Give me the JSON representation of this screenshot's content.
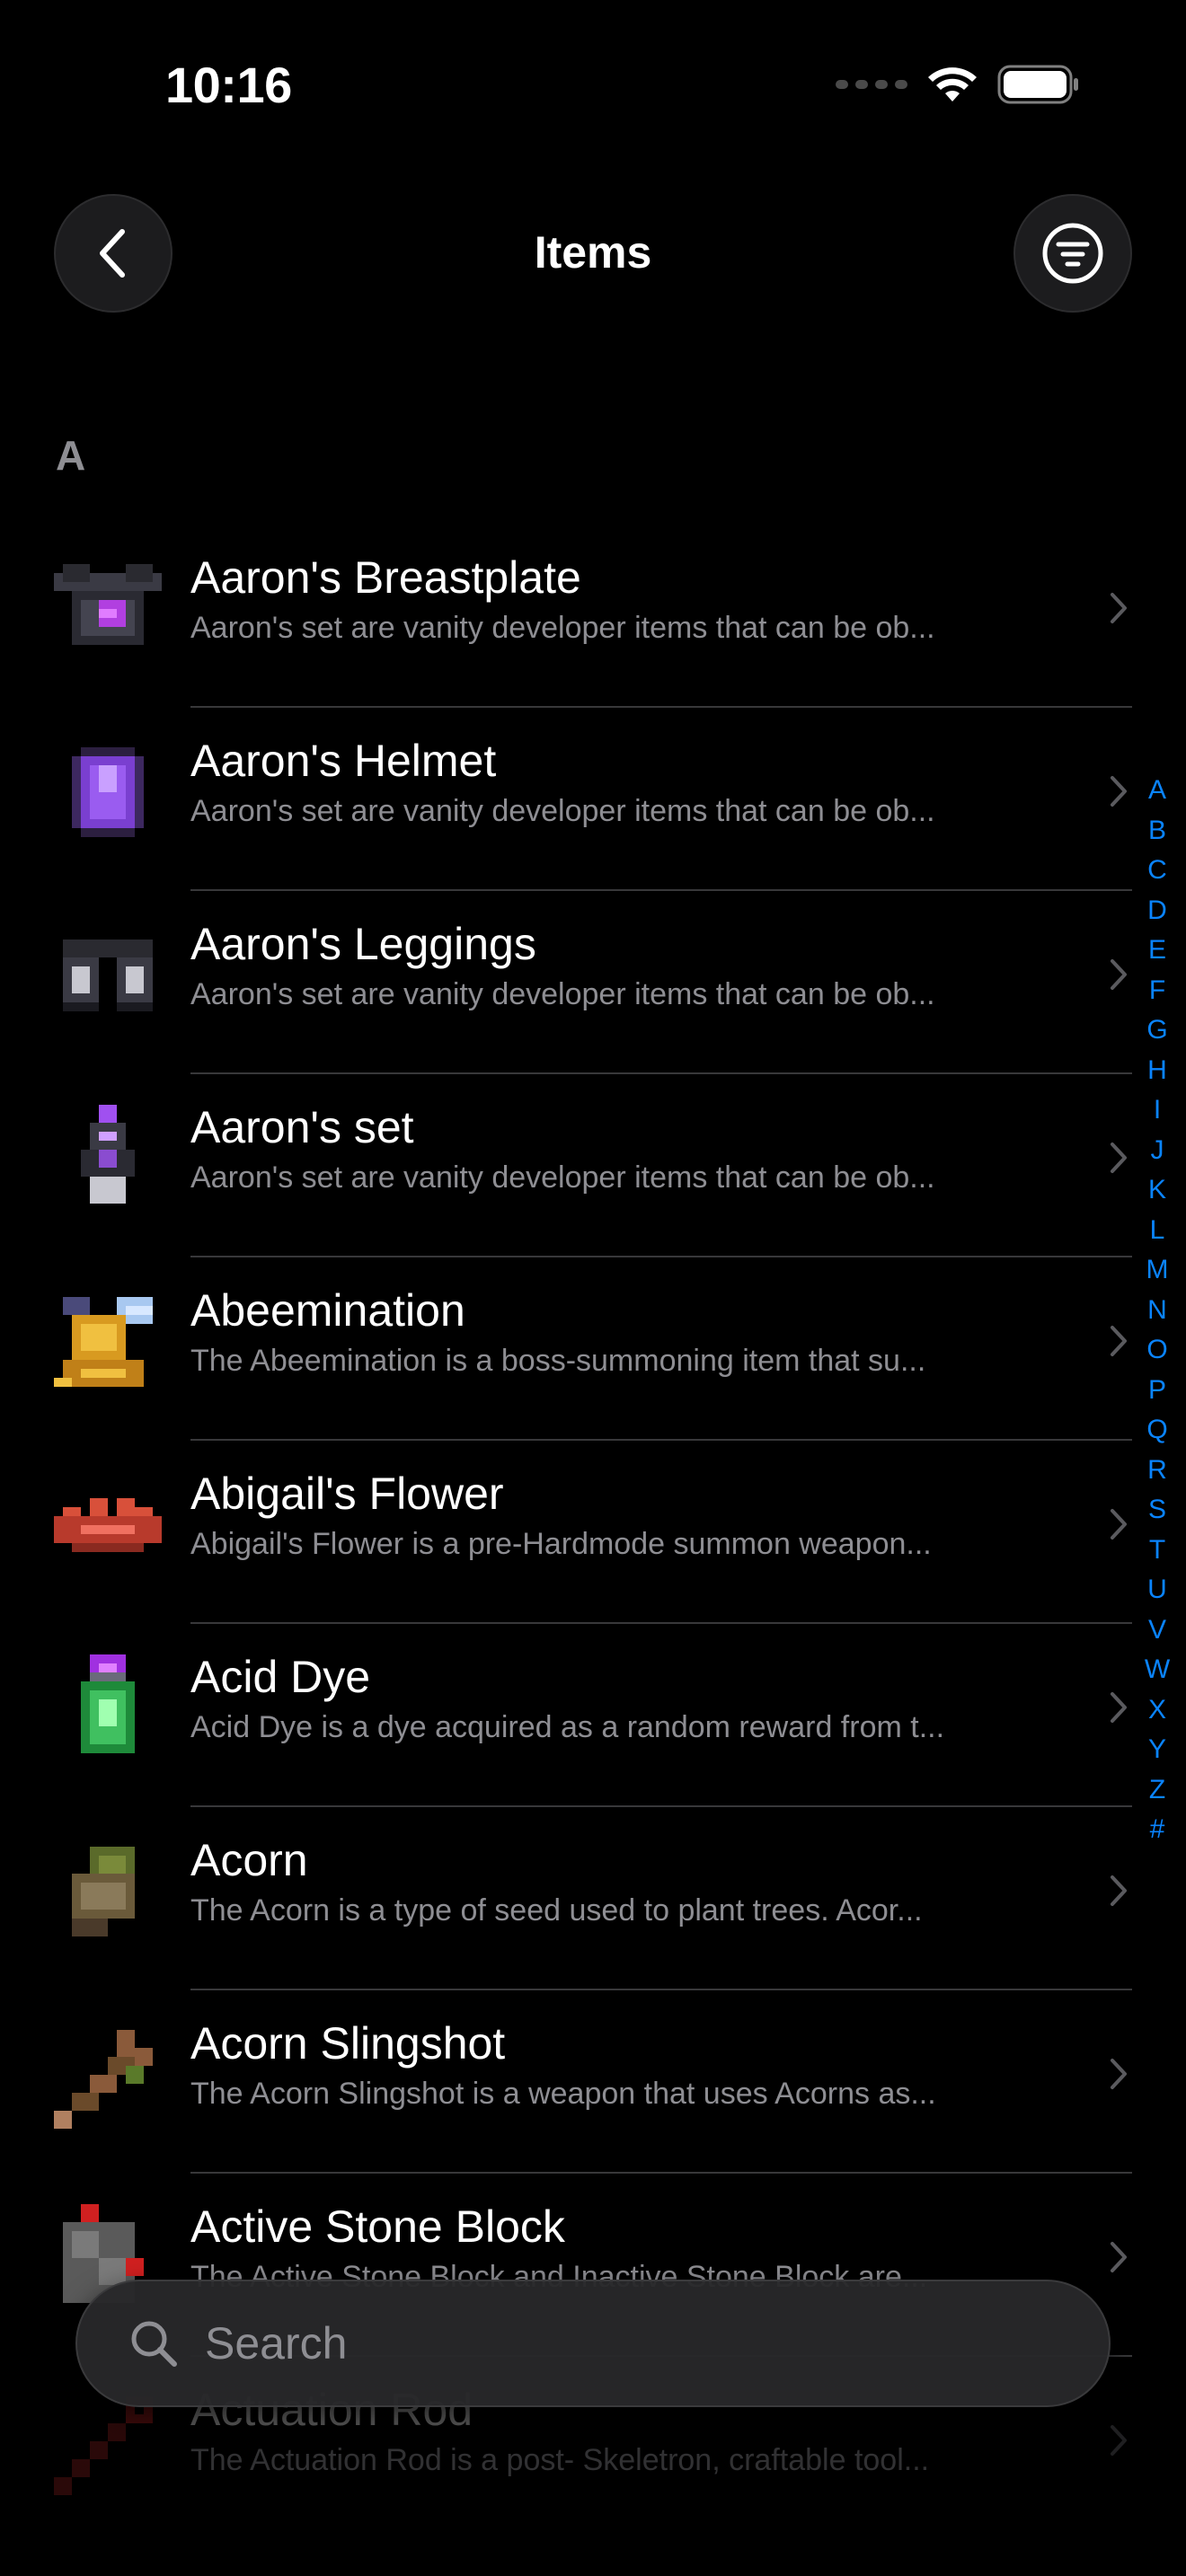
{
  "status": {
    "time": "10:16"
  },
  "nav": {
    "title": "Items"
  },
  "section": {
    "letter": "A"
  },
  "items": [
    {
      "title": "Aaron's Breastplate",
      "subtitle": "Aaron's set are vanity developer items that can be ob...",
      "icon": "breastplate-icon"
    },
    {
      "title": "Aaron's Helmet",
      "subtitle": "Aaron's set are vanity developer items that can be ob...",
      "icon": "helmet-icon"
    },
    {
      "title": "Aaron's Leggings",
      "subtitle": "Aaron's set are vanity developer items that can be ob...",
      "icon": "leggings-icon"
    },
    {
      "title": "Aaron's set",
      "subtitle": "Aaron's set are vanity developer items that can be ob...",
      "icon": "armor-set-icon"
    },
    {
      "title": "Abeemination",
      "subtitle": "The Abeemination is a boss-summoning item that su...",
      "icon": "abeemination-icon"
    },
    {
      "title": "Abigail's Flower",
      "subtitle": "Abigail's Flower is a pre-Hardmode summon weapon...",
      "icon": "flower-icon"
    },
    {
      "title": "Acid Dye",
      "subtitle": "Acid Dye is a dye acquired as a random reward from t...",
      "icon": "dye-bottle-icon"
    },
    {
      "title": "Acorn",
      "subtitle": "The Acorn is a type of seed used to plant trees. Acor...",
      "icon": "acorn-icon"
    },
    {
      "title": "Acorn Slingshot",
      "subtitle": "The Acorn Slingshot is a weapon that uses Acorns as...",
      "icon": "slingshot-icon"
    },
    {
      "title": "Active Stone Block",
      "subtitle": "The Active Stone Block and Inactive Stone Block are...",
      "icon": "stone-block-icon"
    },
    {
      "title": "Actuation Rod",
      "subtitle": "The Actuation Rod is a post- Skeletron, craftable tool...",
      "icon": "rod-icon"
    }
  ],
  "index": [
    "A",
    "B",
    "C",
    "D",
    "E",
    "F",
    "G",
    "H",
    "I",
    "J",
    "K",
    "L",
    "M",
    "N",
    "O",
    "P",
    "Q",
    "R",
    "S",
    "T",
    "U",
    "V",
    "W",
    "X",
    "Y",
    "Z",
    "#"
  ],
  "search": {
    "placeholder": "Search"
  },
  "colors": {
    "accent": "#0a84ff",
    "background": "#000000",
    "secondary_text": "#8e8e93"
  }
}
